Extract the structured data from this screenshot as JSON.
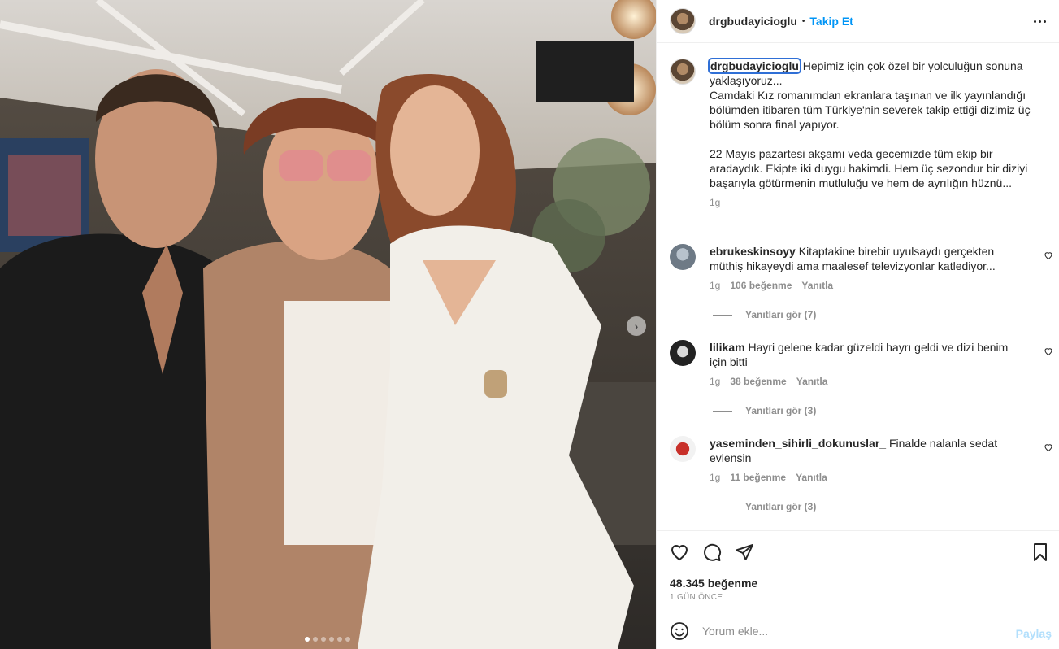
{
  "post": {
    "username": "drgbudayicioglu",
    "separator": "•",
    "follow_label": "Takip Et",
    "more_icon": "more-horizontal-icon"
  },
  "photo": {
    "carousel_total": 6,
    "carousel_active": 1,
    "next_icon": "chevron-right-icon"
  },
  "caption": {
    "username": "drgbudayicioglu",
    "text": " Hepimiz için çok özel bir yolculuğun sonuna yaklaşıyoruz...\nCamdaki Kız romanımdan ekranlara taşınan ve ilk yayınlandığı bölümden itibaren tüm Türkiye'nin severek takip ettiği dizimiz üç bölüm sonra final yapıyor.\n\n22 Mayıs pazartesi akşamı veda gecemizde tüm ekip bir aradaydık. Ekipte iki duygu hakimdi. Hem üç sezondur bir diziyi başarıyla götürmenin mutluluğu ve hem de ayrılığın hüznü...",
    "time": "1g"
  },
  "comments": [
    {
      "username": "ebrukeskinsoyy",
      "text": " Kitaptakine birebir uyulsaydı gerçekten müthiş hikayeydi ama maalesef televizyonlar katlediyor...",
      "time": "1g",
      "likes": "106 beğenme",
      "reply": "Yanıtla",
      "view_replies": "Yanıtları gör (7)",
      "avatar_color": "#7a8794"
    },
    {
      "username": "lilikam",
      "text": " Hayri gelene kadar güzeldi hayrı geldi ve dizi benim için bitti",
      "time": "1g",
      "likes": "38 beğenme",
      "reply": "Yanıtla",
      "view_replies": "Yanıtları gör (3)",
      "avatar_color": "#2b2b2b"
    },
    {
      "username": "yaseminden_sihirli_dokunuslar_",
      "text": " Finalde nalanla sedat evlensin",
      "time": "1g",
      "likes": "11 beğenme",
      "reply": "Yanıtla",
      "view_replies": "Yanıtları gör (3)",
      "avatar_color": "#c8302a"
    }
  ],
  "actions": {
    "like_icon": "heart-icon",
    "comment_icon": "comment-icon",
    "share_icon": "send-icon",
    "save_icon": "bookmark-icon",
    "likes_count": "48.345 beğenme",
    "posted_ago": "1 GÜN ÖNCE"
  },
  "add_comment": {
    "emoji_icon": "emoji-icon",
    "placeholder": "Yorum ekle...",
    "share_label": "Paylaş"
  }
}
